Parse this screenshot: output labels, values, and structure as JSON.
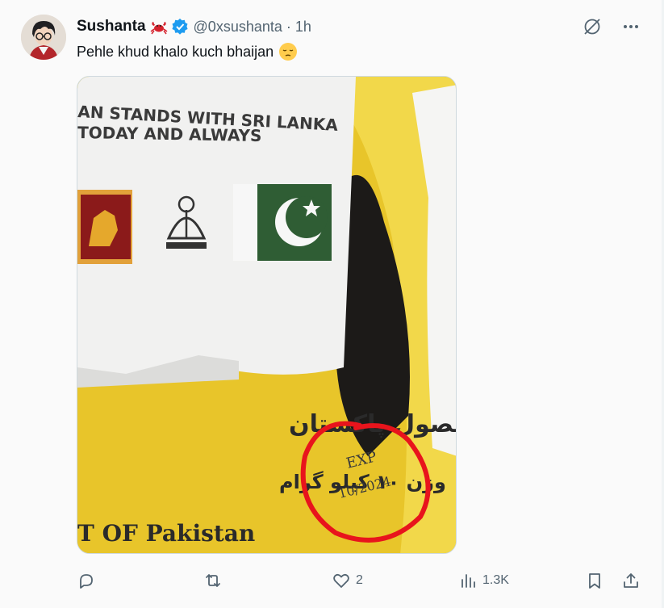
{
  "tweet": {
    "display_name": "Sushanta",
    "handle": "@0xsushanta",
    "separator": "·",
    "time": "1h",
    "text": "Pehle khud khalo kuch bhaijan",
    "name_emoji": "crab-emoji",
    "text_emoji": "pensive-face-emoji",
    "verified": true
  },
  "media": {
    "paper_line1": "AN STANDS WITH SRI LANKA",
    "paper_line2": "TODAY AND ALWAYS",
    "urdu_line1": "محصول پاکستان",
    "urdu_line2": "وزن ۱۰ کیلو گرام",
    "bag_english": "T OF Pakistan",
    "stamp_line1": "EXP",
    "stamp_line2": "10/2024"
  },
  "actions": {
    "reply_count": "",
    "retweet_count": "",
    "like_count": "2",
    "views_count": "1.3K"
  },
  "colors": {
    "accent": "#1d9bf0",
    "text_primary": "#0f1419",
    "text_secondary": "#536471",
    "bag_yellow": "#e8c52a",
    "circle_red": "#e8141c",
    "pak_green": "#2f5d34",
    "srilanka_maroon": "#8b1a1a"
  }
}
